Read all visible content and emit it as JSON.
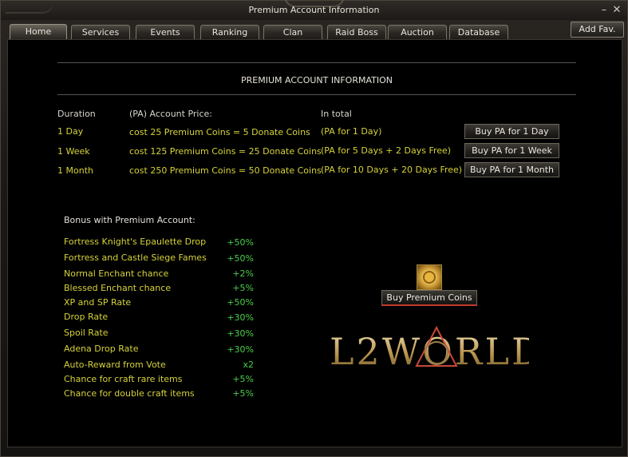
{
  "window": {
    "title": "Premium Account Information"
  },
  "tabs": [
    {
      "label": "Home",
      "active": true
    },
    {
      "label": "Services"
    },
    {
      "label": "Events"
    },
    {
      "label": "Ranking"
    },
    {
      "label": "Clan"
    },
    {
      "label": "Raid Boss"
    },
    {
      "label": "Auction"
    },
    {
      "label": "Database"
    }
  ],
  "add_fav_label": "Add Fav.",
  "header": "PREMIUM ACCOUNT INFORMATION",
  "columns": {
    "duration": "Duration",
    "price": "(PA) Account Price:",
    "total": "In total"
  },
  "plans": [
    {
      "duration": "1 Day",
      "price": "cost 25 Premium Coins = 5 Donate Coins",
      "total": "(PA for 1 Day)",
      "button": "Buy PA for 1 Day"
    },
    {
      "duration": "1 Week",
      "price": "cost 125 Premium Coins = 25 Donate Coins",
      "total": "(PA for 5 Days + 2 Days Free)",
      "button": "Buy PA for 1 Week"
    },
    {
      "duration": "1 Month",
      "price": "cost 250 Premium Coins = 50 Donate Coins",
      "total": "(PA for 10 Days + 20 Days Free)",
      "button": "Buy PA for 1 Month"
    }
  ],
  "bonus": {
    "title": "Bonus with Premium Account:",
    "items": [
      {
        "name": "Fortress Knight's Epaulette Drop",
        "value": "+50%"
      },
      {
        "name": "Fortress and Castle Siege Fames",
        "value": "+50%"
      },
      {
        "name": "Normal Enchant chance",
        "value": "+2%"
      },
      {
        "name": "Blessed Enchant chance",
        "value": "+5%"
      },
      {
        "name": "XP and SP Rate",
        "value": "+50%"
      },
      {
        "name": "Drop Rate",
        "value": "+30%"
      },
      {
        "name": "Spoil Rate",
        "value": "+30%"
      },
      {
        "name": "Adena Drop Rate",
        "value": "+30%"
      },
      {
        "name": "Auto-Reward from Vote",
        "value": "x2"
      },
      {
        "name": "Chance for craft rare items",
        "value": "+5%"
      },
      {
        "name": "Chance for double craft items",
        "value": "+5%"
      }
    ]
  },
  "buy_coins_label": "Buy Premium Coins",
  "logo_text": "L2WORLD",
  "icons": {
    "minimize": "minimize-icon",
    "close": "close-icon",
    "coin": "premium-coin-icon"
  },
  "colors": {
    "yellow": "#d6d23a",
    "green": "#4bd04b",
    "accent_red": "#c23a2a"
  }
}
